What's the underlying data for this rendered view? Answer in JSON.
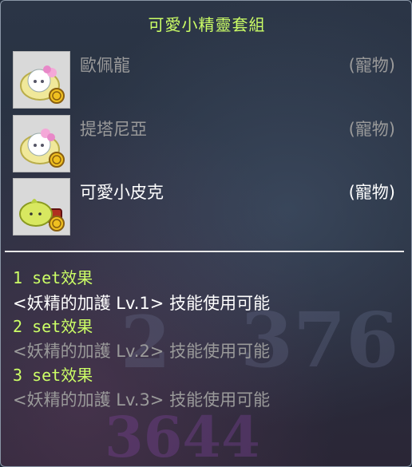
{
  "tooltip": {
    "title": "可愛小精靈套組",
    "items": [
      {
        "name": "歐佩龍",
        "type": "(寵物)",
        "owned": false,
        "icon": "fairy-pet-icon"
      },
      {
        "name": "提塔尼亞",
        "type": "(寵物)",
        "owned": false,
        "icon": "fairy-pet-icon"
      },
      {
        "name": "可愛小皮克",
        "type": "(寵物)",
        "owned": true,
        "icon": "pixie-pet-icon"
      }
    ],
    "set_effects": [
      {
        "label": "1 set效果",
        "desc": "<妖精的加護 Lv.1> 技能使用可能",
        "active": true
      },
      {
        "label": "2 set效果",
        "desc": "<妖精的加護 Lv.2> 技能使用可能",
        "active": false
      },
      {
        "label": "3 set效果",
        "desc": "<妖精的加護 Lv.3> 技能使用可能",
        "active": false
      }
    ],
    "colors": {
      "title": "#ccff66",
      "active_text": "#ffffff",
      "inactive_text": "#9a9a9a"
    }
  }
}
